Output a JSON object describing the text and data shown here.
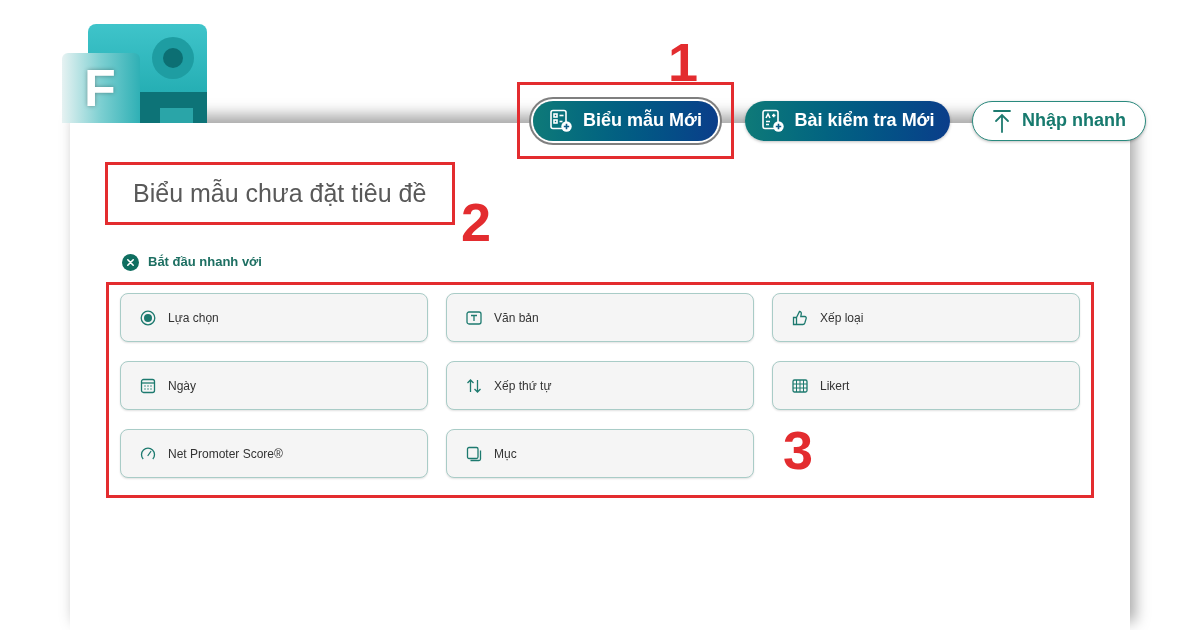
{
  "logo": {
    "letter": "F"
  },
  "toolbar": {
    "buttons": [
      {
        "label": "Biểu mẫu Mới",
        "kind": "filled",
        "focused": true
      },
      {
        "label": "Bài kiểm tra Mới",
        "kind": "filled",
        "focused": false
      },
      {
        "label": "Nhập nhanh",
        "kind": "outline",
        "focused": false
      }
    ]
  },
  "form": {
    "title": "Biểu mẫu chưa đặt tiêu đề",
    "quick_start": {
      "label": "Bắt đầu nhanh với",
      "question_types": [
        {
          "label": "Lựa chọn"
        },
        {
          "label": "Văn bản"
        },
        {
          "label": "Xếp loại"
        },
        {
          "label": "Ngày"
        },
        {
          "label": "Xếp thứ tự"
        },
        {
          "label": "Likert"
        },
        {
          "label": "Net Promoter Score®"
        },
        {
          "label": "Mục"
        }
      ]
    }
  },
  "annotations": [
    {
      "label": "1"
    },
    {
      "label": "2"
    },
    {
      "label": "3"
    }
  ]
}
